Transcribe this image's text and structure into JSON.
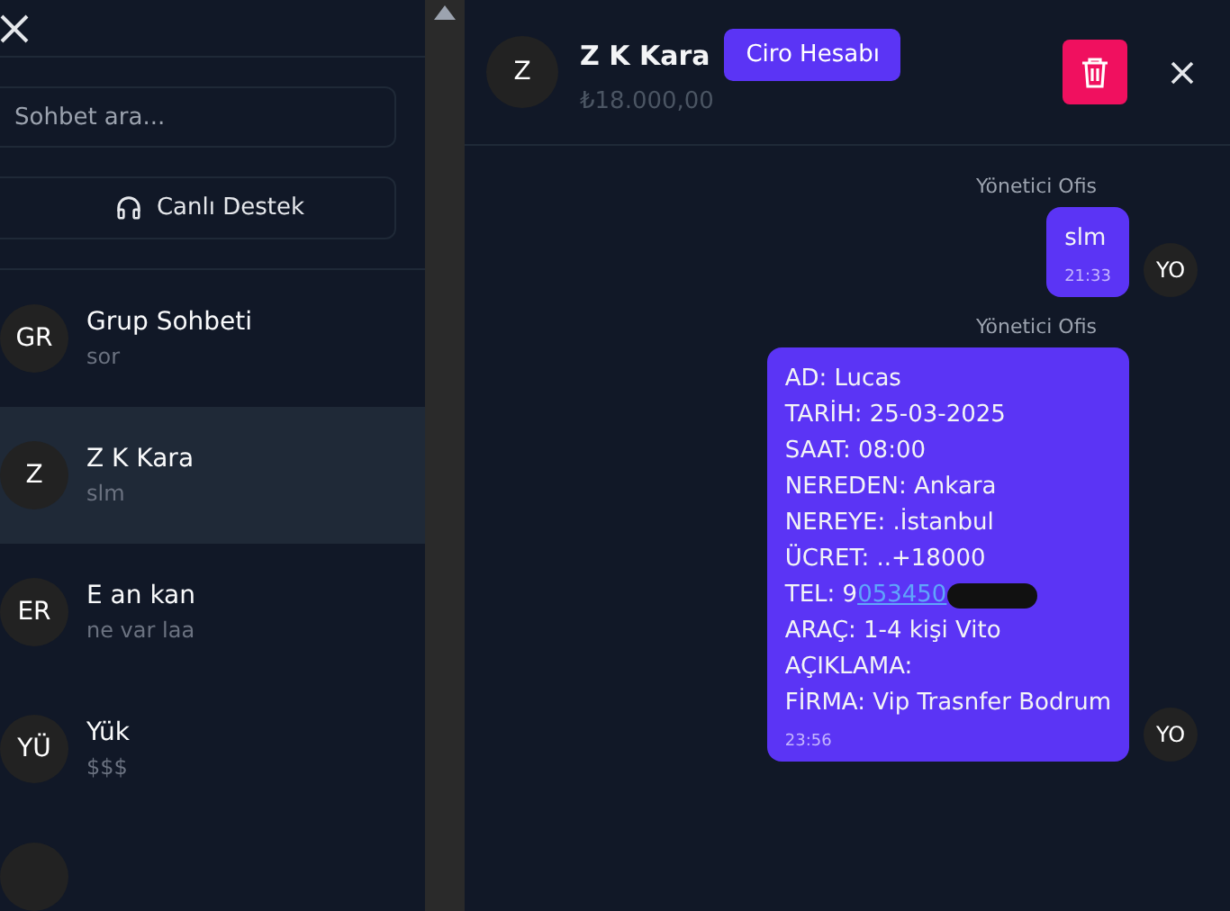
{
  "sidebar": {
    "search": {
      "placeholder": "Sohbet ara..."
    },
    "support_button": "Canlı Destek",
    "chats": [
      {
        "initials": "GR",
        "name": "Grup Sohbeti",
        "last": "sor",
        "selected": false
      },
      {
        "initials": "Z",
        "name": "Z K Kara",
        "last": "slm",
        "selected": true
      },
      {
        "initials": "ER",
        "name": "E  an  kan",
        "last": "ne var laa",
        "selected": false
      },
      {
        "initials": "YÜ",
        "name": "Yük",
        "last": "$$$",
        "selected": false
      }
    ]
  },
  "header": {
    "initials": "Z",
    "name": "Z K Kara",
    "badge": "Ciro Hesabı",
    "amount": "₺18.000,00"
  },
  "messages": [
    {
      "sender": "Yönetici Ofis",
      "avatar": "YO",
      "time": "21:33",
      "lines": [
        {
          "text": "slm"
        }
      ]
    },
    {
      "sender": "Yönetici Ofis",
      "avatar": "YO",
      "time": "23:56",
      "lines": [
        {
          "text": "AD: Lucas"
        },
        {
          "text": "TARİH: 25-03-2025"
        },
        {
          "text": "SAAT: 08:00"
        },
        {
          "text": "NEREDEN: Ankara"
        },
        {
          "text": "NEREYE: .İstanbul"
        },
        {
          "text": "ÜCRET: ..+18000"
        },
        {
          "text": "TEL: 9",
          "link": "053450",
          "redacted": true
        },
        {
          "text": "ARAÇ: 1-4 kişi Vito"
        },
        {
          "text": "AÇIKLAMA:"
        },
        {
          "text": "FİRMA: Vip Trasnfer Bodrum"
        }
      ]
    }
  ]
}
